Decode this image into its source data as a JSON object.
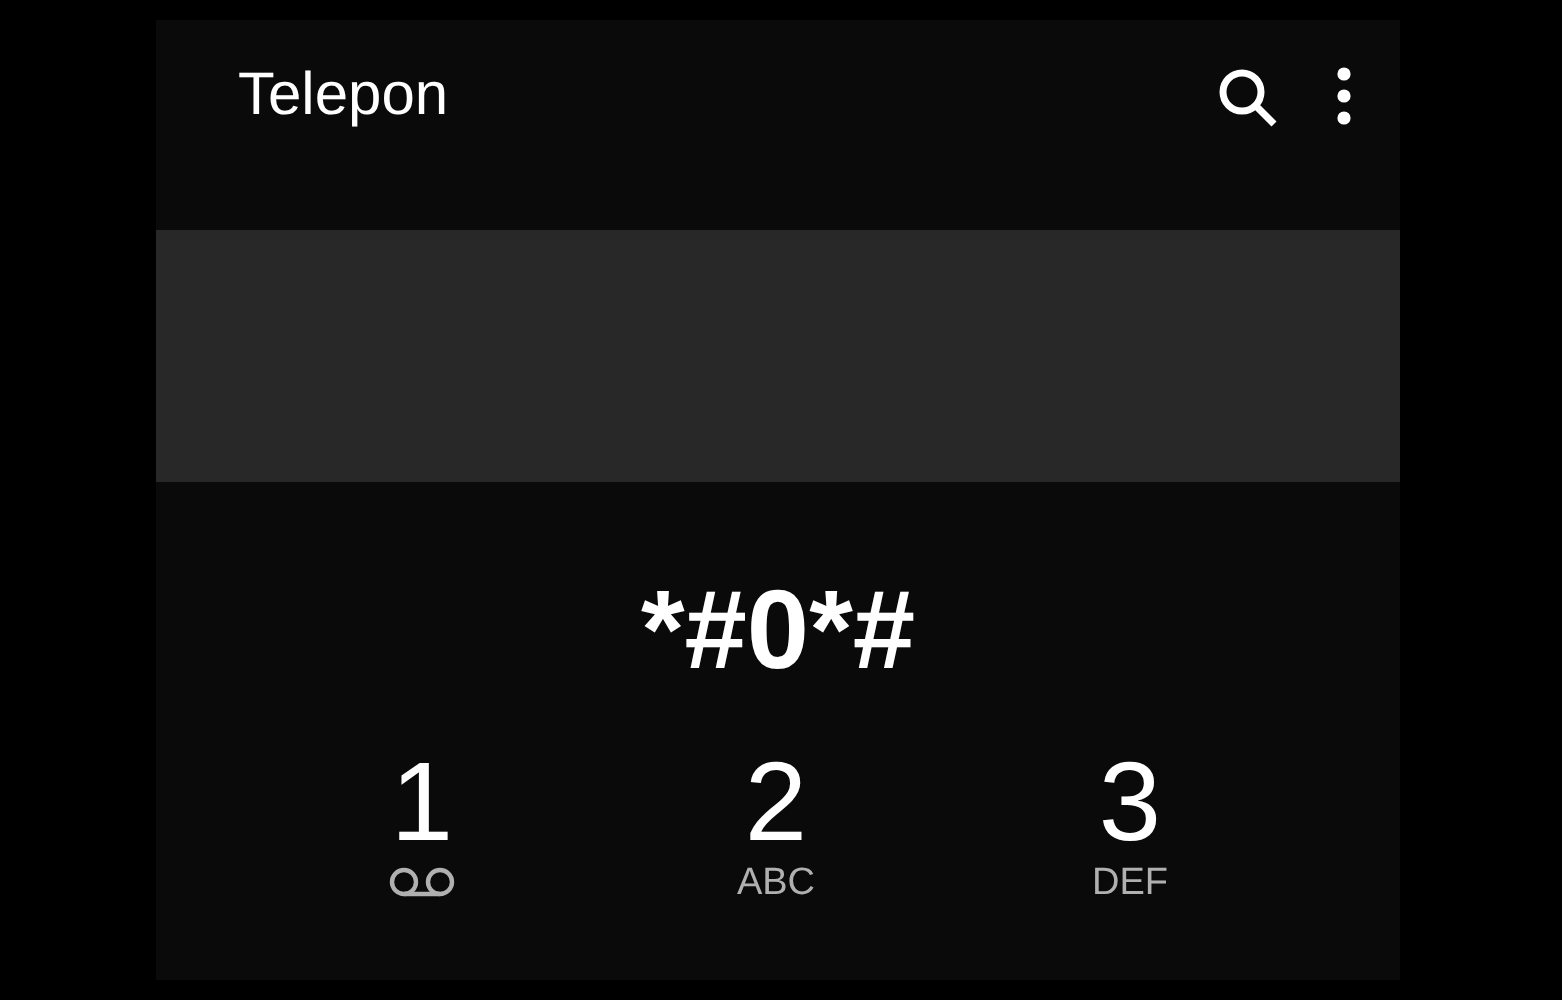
{
  "app_bar": {
    "title": "Telepon"
  },
  "dialed_number": "*#0*#",
  "keys": [
    {
      "digit": "1",
      "kind": "voicemail"
    },
    {
      "digit": "2",
      "kind": "letters",
      "letters": "ABC"
    },
    {
      "digit": "3",
      "kind": "letters",
      "letters": "DEF"
    }
  ]
}
